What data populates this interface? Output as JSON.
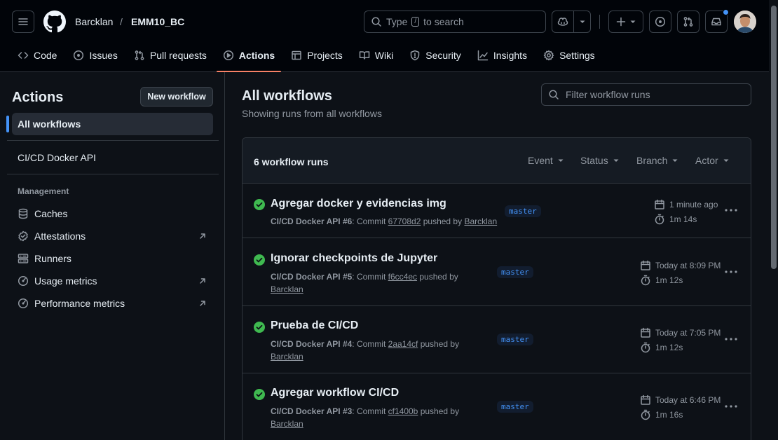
{
  "header": {
    "owner": "Barcklan",
    "separator": "/",
    "repo": "EMM10_BC",
    "search_prefix": "Type",
    "search_key": "/",
    "search_suffix": "to search"
  },
  "tabs": [
    {
      "label": "Code",
      "icon": "code-icon"
    },
    {
      "label": "Issues",
      "icon": "issue-opened-icon"
    },
    {
      "label": "Pull requests",
      "icon": "git-pull-request-icon"
    },
    {
      "label": "Actions",
      "icon": "play-icon",
      "active": true
    },
    {
      "label": "Projects",
      "icon": "table-icon"
    },
    {
      "label": "Wiki",
      "icon": "book-icon"
    },
    {
      "label": "Security",
      "icon": "shield-icon"
    },
    {
      "label": "Insights",
      "icon": "graph-icon"
    },
    {
      "label": "Settings",
      "icon": "gear-icon"
    }
  ],
  "sidebar": {
    "title": "Actions",
    "new_workflow": "New workflow",
    "all_workflows": "All workflows",
    "workflows": [
      "CI/CD Docker API"
    ],
    "management_heading": "Management",
    "management": [
      {
        "label": "Caches",
        "icon": "database-icon"
      },
      {
        "label": "Attestations",
        "icon": "verified-icon",
        "external": true
      },
      {
        "label": "Runners",
        "icon": "server-icon"
      },
      {
        "label": "Usage metrics",
        "icon": "meter-icon",
        "external": true
      },
      {
        "label": "Performance metrics",
        "icon": "meter-icon",
        "external": true
      }
    ]
  },
  "main": {
    "title": "All workflows",
    "subtitle": "Showing runs from all workflows",
    "filter_placeholder": "Filter workflow runs",
    "runs_count": "6 workflow runs",
    "filters": [
      "Event",
      "Status",
      "Branch",
      "Actor"
    ],
    "runs": [
      {
        "title": "Agregar docker y evidencias img",
        "workflow": "CI/CD Docker API",
        "run": "#6",
        "commit_label": "Commit",
        "commit": "67708d2",
        "pushed_by": "pushed by",
        "user": "Barcklan",
        "branch": "master",
        "time": "1 minute ago",
        "duration": "1m 14s"
      },
      {
        "title": "Ignorar checkpoints de Jupyter",
        "workflow": "CI/CD Docker API",
        "run": "#5",
        "commit_label": "Commit",
        "commit": "f6cc4ec",
        "pushed_by": "pushed by",
        "user": "Barcklan",
        "branch": "master",
        "time": "Today at 8:09 PM",
        "duration": "1m 12s"
      },
      {
        "title": "Prueba de CI/CD",
        "workflow": "CI/CD Docker API",
        "run": "#4",
        "commit_label": "Commit",
        "commit": "2aa14cf",
        "pushed_by": "pushed by",
        "user": "Barcklan",
        "branch": "master",
        "time": "Today at 7:05 PM",
        "duration": "1m 12s"
      },
      {
        "title": "Agregar workflow CI/CD",
        "workflow": "CI/CD Docker API",
        "run": "#3",
        "commit_label": "Commit",
        "commit": "cf1400b",
        "pushed_by": "pushed by",
        "user": "Barcklan",
        "branch": "master",
        "time": "Today at 6:46 PM",
        "duration": "1m 16s"
      }
    ]
  },
  "colors": {
    "success": "#3fb950",
    "accent": "#4493f8",
    "tab_underline": "#f78166",
    "bg": "#0d1117"
  }
}
